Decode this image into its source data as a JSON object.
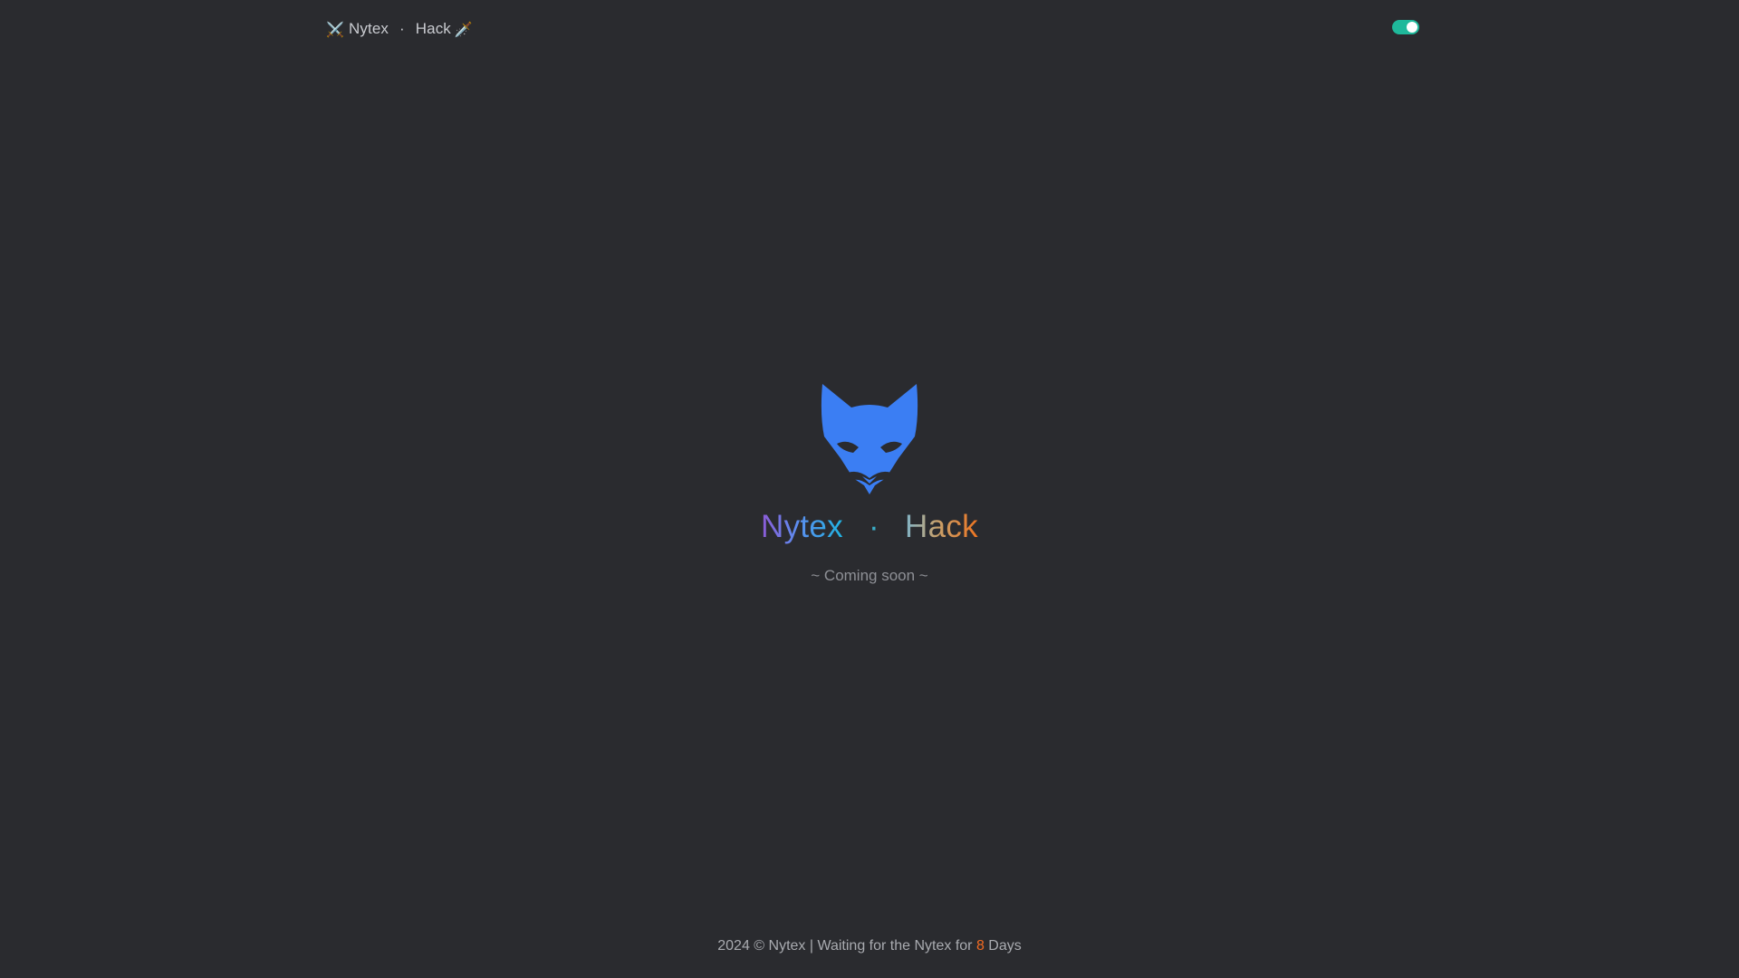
{
  "header": {
    "brand_left_emoji": "⚔️",
    "brand_word1": "Nytex",
    "brand_separator": "·",
    "brand_word2": "Hack",
    "brand_right_emoji": "🗡️",
    "theme_toggle": {
      "state": "on",
      "color": "#1fb99b"
    }
  },
  "hero": {
    "logo_icon": "fox-head-icon",
    "logo_color": "#3b7ef3",
    "title_word1": "Nytex",
    "title_separator": "·",
    "title_word2": "Hack",
    "tagline": "~ Coming soon ~"
  },
  "footer": {
    "prefix": "2024 © Nytex | Waiting for the Nytex for ",
    "days_value": "8",
    "suffix": " Days",
    "accent_color": "#f06a22"
  }
}
